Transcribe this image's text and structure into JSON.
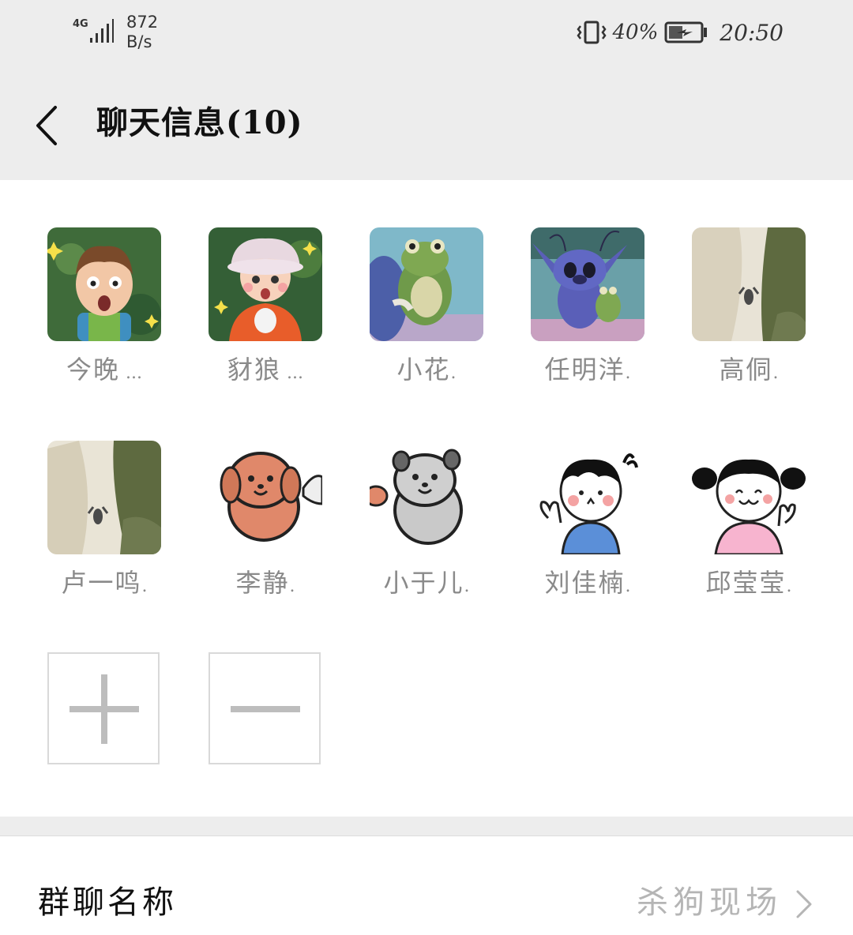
{
  "status_bar": {
    "network": "4G",
    "speed_value": "872",
    "speed_unit": "B/s",
    "battery_percent": "40%",
    "time": "20:50"
  },
  "header": {
    "title": "聊天信息(10)",
    "back_icon": "chevron-left-icon"
  },
  "members": [
    {
      "name": "今晚",
      "truncated": true,
      "avatar": "cartoon-boy-surprised"
    },
    {
      "name": "豺狼",
      "truncated": true,
      "avatar": "cartoon-girl-hat"
    },
    {
      "name": "小花",
      "truncated": false,
      "avatar": "frog-plush"
    },
    {
      "name": "任明洋",
      "truncated": false,
      "avatar": "stitch-holding-frog"
    },
    {
      "name": "高侗",
      "truncated": false,
      "avatar": "white-hoodie-photo"
    },
    {
      "name": "卢一鸣",
      "truncated": false,
      "avatar": "white-hoodie-photo"
    },
    {
      "name": "李静",
      "truncated": false,
      "avatar": "brown-puppy-sticker"
    },
    {
      "name": "小于儿",
      "truncated": false,
      "avatar": "grey-puppy-sticker"
    },
    {
      "name": "刘佳楠",
      "truncated": false,
      "avatar": "cartoon-boy-waving"
    },
    {
      "name": "邱莹莹",
      "truncated": false,
      "avatar": "cartoon-girl-waving"
    }
  ],
  "actions": {
    "add_icon": "plus-icon",
    "remove_icon": "minus-icon"
  },
  "group_name": {
    "label": "群聊名称",
    "value": "杀狗现场"
  },
  "colors": {
    "header_bg": "#ededed",
    "name_gray": "#8a8a8a",
    "value_gray": "#b5b5b5"
  }
}
